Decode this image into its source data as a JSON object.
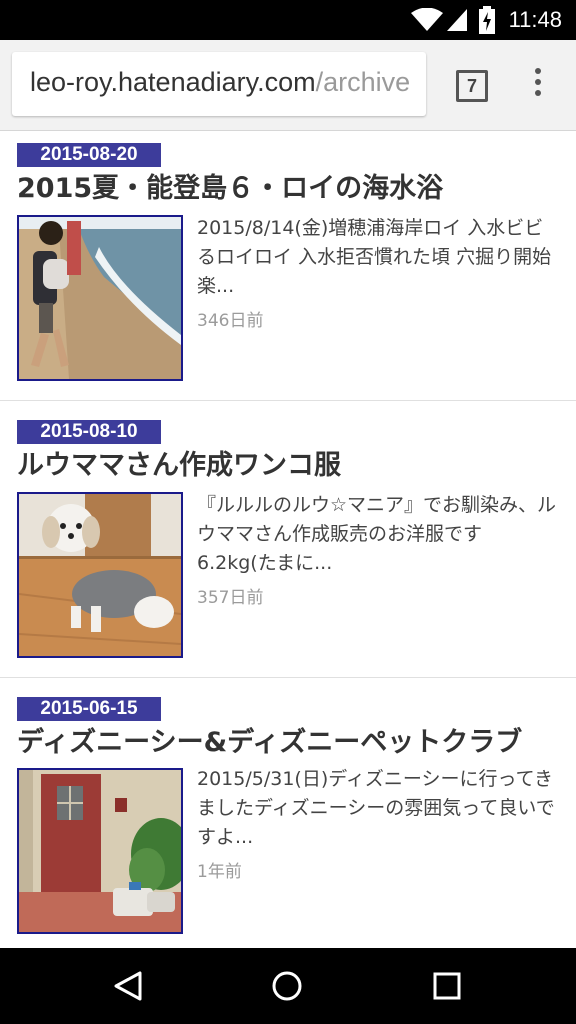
{
  "status_bar": {
    "time": "11:48",
    "icons": [
      "wifi-icon",
      "cell-signal-icon",
      "battery-charging-icon"
    ]
  },
  "browser": {
    "url_host": "leo-roy.hatenadiary.com",
    "url_path": "/archive",
    "tab_count": "7",
    "menu_icon": "overflow-menu-icon"
  },
  "entries": [
    {
      "date": "2015-08-20",
      "title": "2015夏・能登島６・ロイの海水浴",
      "summary": "2015/8/14(金)増穂浦海岸ロイ 入水ビビるロイロイ 入水拒否慣れた頃 穴掘り開始楽...",
      "ago": "346日前",
      "thumb": "beach-photo"
    },
    {
      "date": "2015-08-10",
      "title": "ルウママさん作成ワンコ服",
      "summary": "『ルルルのルウ☆マニア』でお馴染み、ルウママさん作成販売のお洋服です6.2kg(たまに...",
      "ago": "357日前",
      "thumb": "dog-photo"
    },
    {
      "date": "2015-06-15",
      "title": "ディズニーシー&ディズニーペットクラブ",
      "summary": "2015/5/31(日)ディズニーシーに行ってきましたディズニーシーの雰囲気って良いですよ...",
      "ago": "1年前",
      "thumb": "door-photo"
    }
  ],
  "nav_bar": {
    "icons": [
      "back-icon",
      "home-icon",
      "recents-icon"
    ]
  },
  "colors": {
    "badge": "#3d3c9b",
    "thumb_border": "#1a1a8a",
    "ago_text": "#9b9b9b"
  }
}
